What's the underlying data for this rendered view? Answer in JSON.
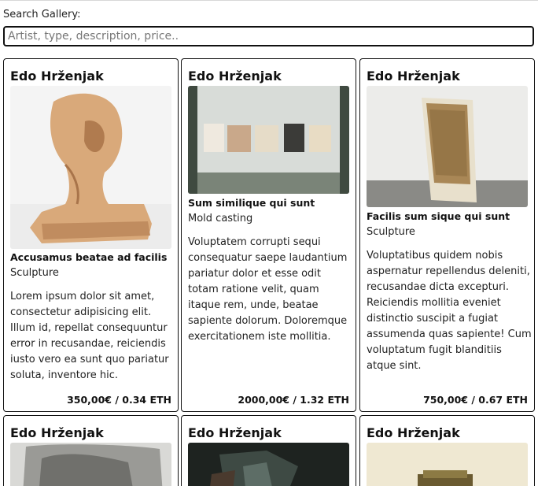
{
  "search": {
    "label": "Search Gallery:",
    "placeholder": "Artist, type, description, price.."
  },
  "cards": [
    {
      "artist": "Edo Hrženjak",
      "title": "Accusamus beatae ad facilis",
      "type": "Sculpture",
      "description": "Lorem ipsum dolor sit amet, consectetur adipisicing elit. Illum id, repellat consequuntur error in recusandae, reiciendis iusto vero ea sunt quo pariatur soluta, inventore hic.",
      "price": "350,00€ / 0.34 ETH",
      "image": "carved wooden sculpture"
    },
    {
      "artist": "Edo Hrženjak",
      "title": "Sum similique qui sunt",
      "type": "Mold casting",
      "description": "Voluptatem corrupti sequi consequatur saepe laudantium pariatur dolor et esse odit totam ratione velit, quam itaque rem, unde, beatae sapiente dolorum. Doloremque exercitationem iste mollitia.",
      "price": "2000,00€ / 1.32 ETH",
      "image": "row of cast tiles on wall"
    },
    {
      "artist": "Edo Hrženjak",
      "title": "Facilis sum sique qui sunt",
      "type": "Sculpture",
      "description": "Voluptatibus quidem nobis aspernatur repellendus deleniti, recusandae dicta excepturi. Reiciendis mollitia eveniet distinctio suscipit a fugiat assumenda quas sapiente! Cum voluptatum fugit blanditiis atque sint.",
      "price": "750,00€ / 0.67 ETH",
      "image": "textured panel leaning on wall"
    },
    {
      "artist": "Edo Hrženjak",
      "image": "charcoal drawing"
    },
    {
      "artist": "Edo Hrženjak",
      "image": "dark painting"
    },
    {
      "artist": "Edo Hrženjak",
      "image": "object on light background"
    }
  ]
}
